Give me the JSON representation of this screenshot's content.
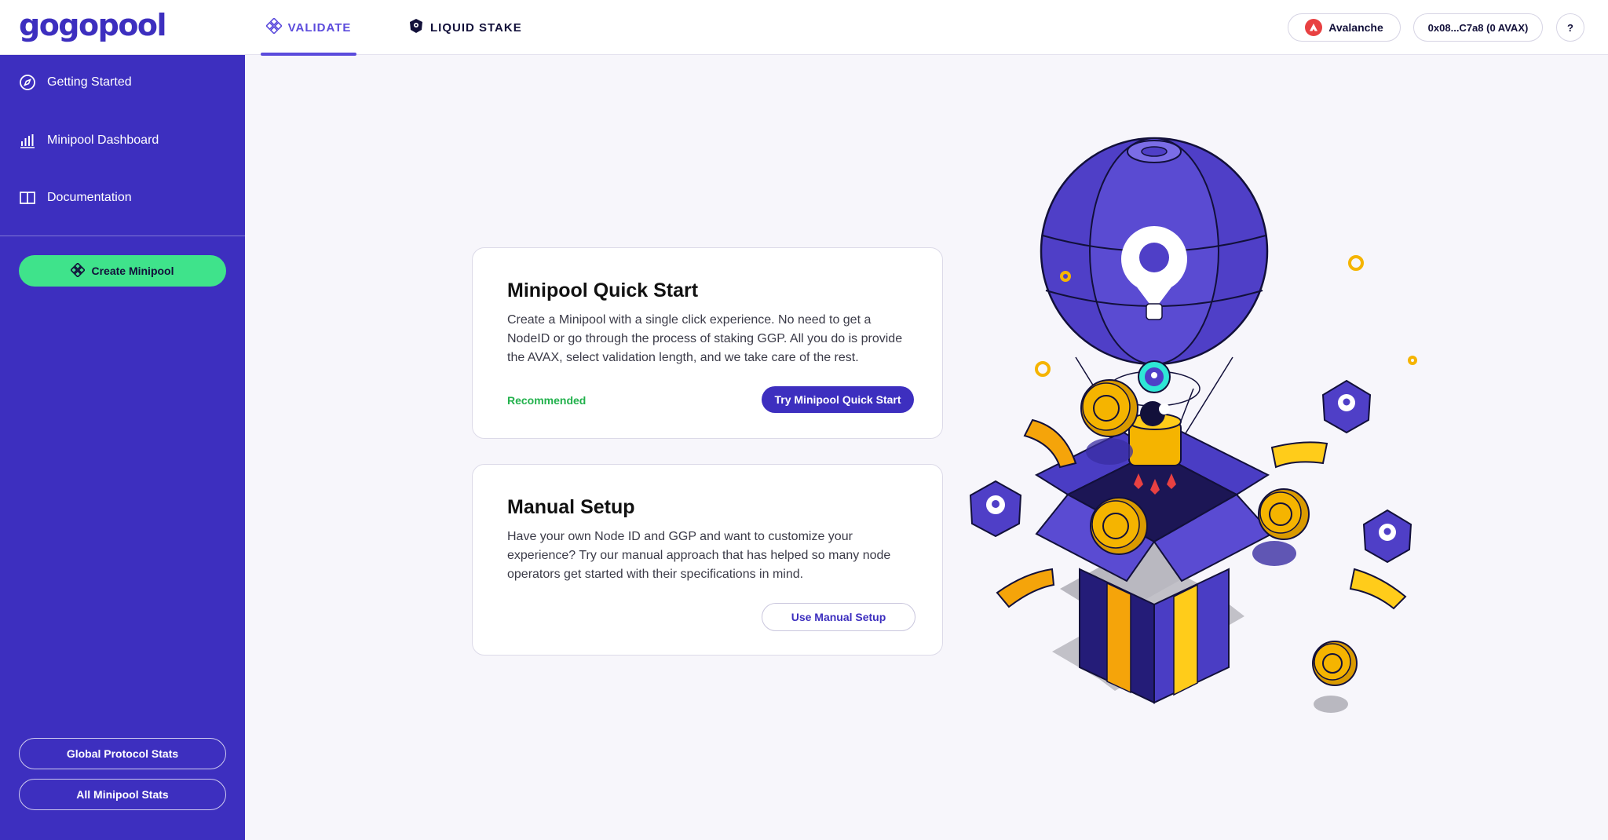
{
  "header": {
    "logo": "gogopool",
    "tabs": [
      {
        "label": "VALIDATE",
        "active": true,
        "icon": "diamond-grid-icon"
      },
      {
        "label": "LIQUID STAKE",
        "active": false,
        "icon": "ggp-hex-icon"
      }
    ],
    "network": {
      "label": "Avalanche",
      "icon": "avalanche-icon",
      "color": "#e84142"
    },
    "wallet": {
      "label": "0x08...C7a8 (0 AVAX)"
    },
    "help": {
      "label": "?"
    }
  },
  "sidebar": {
    "items": [
      {
        "label": "Getting Started",
        "icon": "compass-icon"
      },
      {
        "label": "Minipool Dashboard",
        "icon": "bar-chart-icon"
      },
      {
        "label": "Documentation",
        "icon": "book-icon"
      }
    ],
    "create_button": {
      "label": "Create Minipool",
      "icon": "diamond-grid-icon",
      "color": "#3fe38b"
    },
    "footer_buttons": [
      {
        "label": "Global Protocol Stats"
      },
      {
        "label": "All Minipool Stats"
      }
    ]
  },
  "cards": {
    "quick_start": {
      "title": "Minipool Quick Start",
      "description": "Create a Minipool with a single click experience. No need to get a NodeID or go through the process of staking GGP. All you do is provide the AVAX, select validation length, and we take care of the rest.",
      "badge": "Recommended",
      "button": "Try Minipool Quick Start"
    },
    "manual_setup": {
      "title": "Manual Setup",
      "description": "Have your own Node ID and GGP and want to customize your experience? Try our manual approach that has helped so many node operators get started with their specifications in mind.",
      "button": "Use Manual Setup"
    }
  },
  "colors": {
    "brand": "#3d2fbf",
    "accent": "#5b4bdc",
    "success": "#22b14c",
    "gold": "#f5b400"
  }
}
